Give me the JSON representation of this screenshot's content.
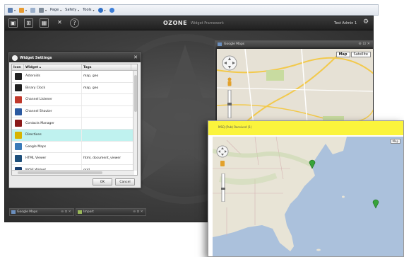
{
  "browser": {
    "menu_page": "Page",
    "menu_safety": "Safety",
    "menu_tools": "Tools"
  },
  "owf": {
    "brand": "OZONE",
    "brand_sub": "Widget Framework",
    "user": "Test Admin 1",
    "toolbar_icons": [
      "launch-menu-icon",
      "dashboards-icon",
      "grid-icon",
      "admin-tools-icon",
      "help-icon"
    ]
  },
  "widget_settings": {
    "title": "Widget Settings",
    "columns": {
      "icon": "Icon",
      "widget": "Widget",
      "tags": "Tags"
    },
    "rows": [
      {
        "name": "Asteroids",
        "tags": "map, geo",
        "color": "#222222"
      },
      {
        "name": "Binary Clock",
        "tags": "map, geo",
        "color": "#1f1f1f"
      },
      {
        "name": "Channel Listener",
        "tags": "",
        "color": "#c0392b"
      },
      {
        "name": "Channel Shouter",
        "tags": "",
        "color": "#2c5aa0"
      },
      {
        "name": "Contacts Manager",
        "tags": "",
        "color": "#8b1a1a"
      },
      {
        "name": "Directions",
        "tags": "",
        "color": "#d8b400"
      },
      {
        "name": "Google Maps",
        "tags": "",
        "color": "#3a7ab8"
      },
      {
        "name": "HTML Viewer",
        "tags": "html, document_viewer",
        "color": "#1e4f7a"
      },
      {
        "name": "NYSE Widget",
        "tags": "grid",
        "color": "#1a3f6e"
      }
    ],
    "selected_index": 5,
    "ok_label": "OK",
    "cancel_label": "Cancel"
  },
  "google_maps_widget": {
    "title": "Google Maps",
    "map_button": "Map",
    "satellite_button": "Satellite"
  },
  "taskbar": [
    {
      "label": "Google Maps"
    },
    {
      "label": "Import"
    }
  ],
  "zoomed_map": {
    "header_text": "MSQ (Pub) Received (1)",
    "map_button": "Map"
  }
}
